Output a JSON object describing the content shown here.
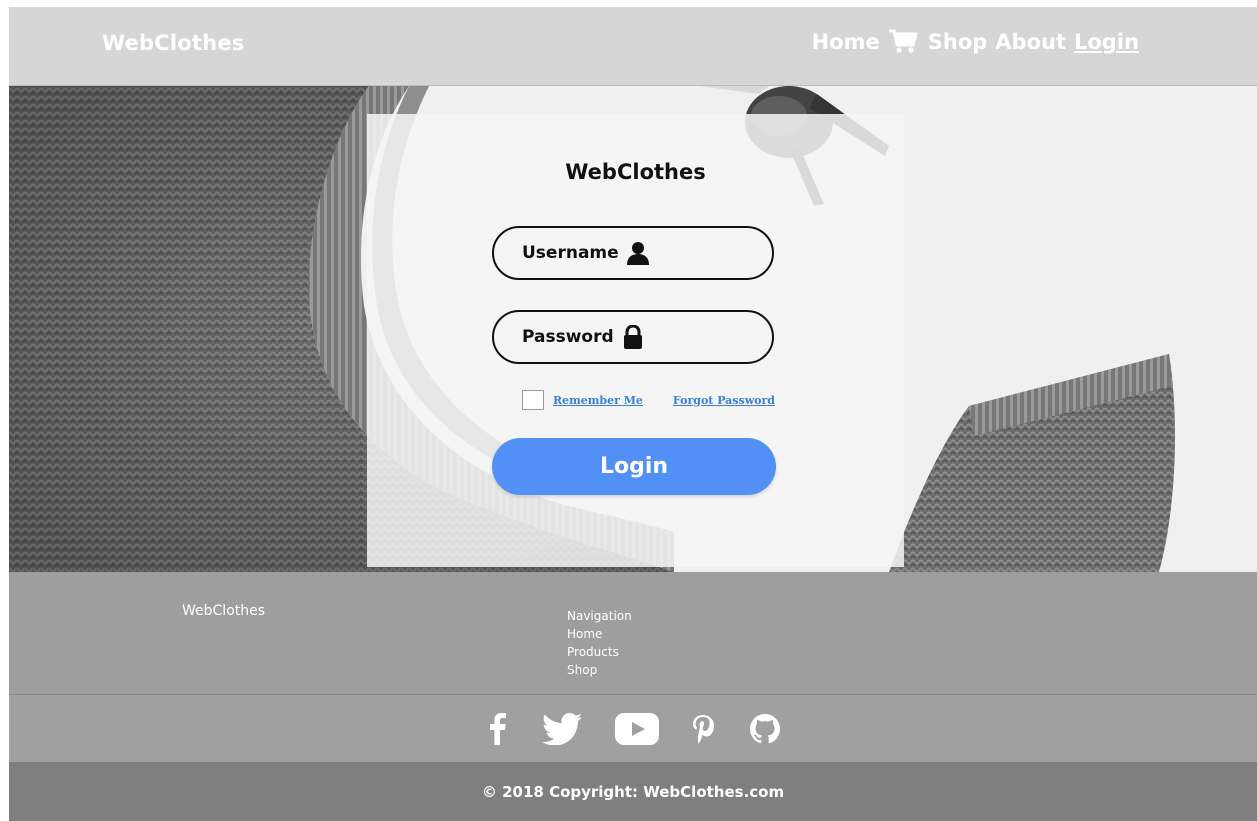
{
  "header": {
    "brand": "WebClothes",
    "nav": {
      "home": "Home",
      "cart_icon": "shopping-cart-icon",
      "shop": "Shop",
      "about": "About",
      "login": "Login"
    }
  },
  "login": {
    "title": "WebClothes",
    "username_placeholder": "Username",
    "username_icon": "user-icon",
    "password_placeholder": "Password",
    "password_icon": "lock-icon",
    "remember_me": "Remember Me",
    "forgot_password": "Forgot Password",
    "button": "Login"
  },
  "footer": {
    "brand": "WebClothes",
    "nav_heading": "Navigation",
    "links": [
      "Home",
      "Products",
      "Shop"
    ],
    "social": [
      "facebook-icon",
      "twitter-icon",
      "youtube-icon",
      "pinterest-icon",
      "github-icon"
    ],
    "copyright": "© 2018 Copyright: WebClothes.com"
  },
  "colors": {
    "header_bg": "#d6d6d6",
    "login_button": "#5390f5",
    "link": "#3b7fd8",
    "footer_bg": "#9e9e9e",
    "copyright_bg": "#7f7f7f"
  }
}
